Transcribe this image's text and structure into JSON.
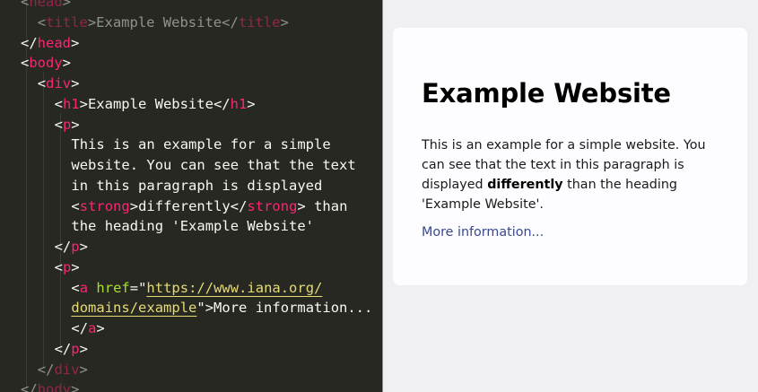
{
  "editor": {
    "lines": [
      {
        "indent": 1,
        "dim": true,
        "tokens": [
          {
            "t": "<",
            "c": "bk"
          },
          {
            "t": "head",
            "c": "tg"
          },
          {
            "t": ">",
            "c": "bk"
          }
        ]
      },
      {
        "indent": 2,
        "dim": true,
        "tokens": [
          {
            "t": "<",
            "c": "bk"
          },
          {
            "t": "title",
            "c": "tg"
          },
          {
            "t": ">",
            "c": "bk"
          },
          {
            "t": "Example Website",
            "c": "bk"
          },
          {
            "t": "</",
            "c": "bk"
          },
          {
            "t": "title",
            "c": "tg"
          },
          {
            "t": ">",
            "c": "bk"
          }
        ]
      },
      {
        "indent": 1,
        "dim": false,
        "tokens": [
          {
            "t": "</",
            "c": "bk"
          },
          {
            "t": "head",
            "c": "tg"
          },
          {
            "t": ">",
            "c": "bk"
          }
        ]
      },
      {
        "indent": 1,
        "dim": false,
        "tokens": [
          {
            "t": "<",
            "c": "bk"
          },
          {
            "t": "body",
            "c": "tg"
          },
          {
            "t": ">",
            "c": "bk"
          }
        ]
      },
      {
        "indent": 2,
        "dim": false,
        "tokens": [
          {
            "t": "<",
            "c": "bk"
          },
          {
            "t": "div",
            "c": "tg"
          },
          {
            "t": ">",
            "c": "bk"
          }
        ]
      },
      {
        "indent": 3,
        "dim": false,
        "tokens": [
          {
            "t": "<",
            "c": "bk"
          },
          {
            "t": "h1",
            "c": "tg"
          },
          {
            "t": ">",
            "c": "bk"
          },
          {
            "t": "Example Website",
            "c": "bk"
          },
          {
            "t": "</",
            "c": "bk"
          },
          {
            "t": "h1",
            "c": "tg"
          },
          {
            "t": ">",
            "c": "bk"
          }
        ]
      },
      {
        "indent": 3,
        "dim": false,
        "tokens": [
          {
            "t": "<",
            "c": "bk"
          },
          {
            "t": "p",
            "c": "tg"
          },
          {
            "t": ">",
            "c": "bk"
          }
        ]
      },
      {
        "indent": 4,
        "dim": false,
        "tokens": [
          {
            "t": "This is an example for a simple",
            "c": "bk"
          }
        ]
      },
      {
        "indent": 4,
        "dim": false,
        "tokens": [
          {
            "t": "website. You can see that the text",
            "c": "bk"
          }
        ]
      },
      {
        "indent": 4,
        "dim": false,
        "tokens": [
          {
            "t": "in this paragraph is displayed",
            "c": "bk"
          }
        ]
      },
      {
        "indent": 4,
        "dim": false,
        "tokens": [
          {
            "t": "<",
            "c": "bk"
          },
          {
            "t": "strong",
            "c": "tg"
          },
          {
            "t": ">",
            "c": "bk"
          },
          {
            "t": "differently",
            "c": "bk"
          },
          {
            "t": "</",
            "c": "bk"
          },
          {
            "t": "strong",
            "c": "tg"
          },
          {
            "t": ">",
            "c": "bk"
          },
          {
            "t": " than",
            "c": "bk"
          }
        ]
      },
      {
        "indent": 4,
        "dim": false,
        "tokens": [
          {
            "t": "the heading 'Example Website'",
            "c": "bk"
          }
        ]
      },
      {
        "indent": 3,
        "dim": false,
        "tokens": [
          {
            "t": "</",
            "c": "bk"
          },
          {
            "t": "p",
            "c": "tg"
          },
          {
            "t": ">",
            "c": "bk"
          }
        ]
      },
      {
        "indent": 3,
        "dim": false,
        "tokens": [
          {
            "t": "<",
            "c": "bk"
          },
          {
            "t": "p",
            "c": "tg"
          },
          {
            "t": ">",
            "c": "bk"
          }
        ]
      },
      {
        "indent": 4,
        "dim": false,
        "tokens": [
          {
            "t": "<",
            "c": "bk"
          },
          {
            "t": "a",
            "c": "tg"
          },
          {
            "t": " ",
            "c": "bk"
          },
          {
            "t": "href",
            "c": "at"
          },
          {
            "t": "=\"",
            "c": "bk"
          },
          {
            "t": "https://www.iana.org/",
            "c": "sv"
          }
        ]
      },
      {
        "indent": 4,
        "dim": false,
        "tokens": [
          {
            "t": "domains/example",
            "c": "sv"
          },
          {
            "t": "\">",
            "c": "bk"
          },
          {
            "t": "More information...",
            "c": "bk"
          }
        ]
      },
      {
        "indent": 4,
        "dim": false,
        "tokens": [
          {
            "t": "</",
            "c": "bk"
          },
          {
            "t": "a",
            "c": "tg"
          },
          {
            "t": ">",
            "c": "bk"
          }
        ]
      },
      {
        "indent": 3,
        "dim": false,
        "tokens": [
          {
            "t": "</",
            "c": "bk"
          },
          {
            "t": "p",
            "c": "tg"
          },
          {
            "t": ">",
            "c": "bk"
          }
        ]
      },
      {
        "indent": 2,
        "dim": true,
        "tokens": [
          {
            "t": "</",
            "c": "bk"
          },
          {
            "t": "div",
            "c": "tg"
          },
          {
            "t": ">",
            "c": "bk"
          }
        ]
      },
      {
        "indent": 1,
        "dim": true,
        "tokens": [
          {
            "t": "</",
            "c": "bk"
          },
          {
            "t": "body",
            "c": "tg"
          },
          {
            "t": ">",
            "c": "bk"
          }
        ]
      }
    ]
  },
  "preview": {
    "heading": "Example Website",
    "paragraph_before": "This is an example for a simple website. You can see that the text in this paragraph is displayed ",
    "paragraph_strong": "differently",
    "paragraph_after": " than the heading 'Example Website'.",
    "link_text": "More information..."
  },
  "colors": {
    "editor_bg": "#272822",
    "tag": "#f92672",
    "attribute": "#a6e22e",
    "string": "#e6db74",
    "text": "#f8f8f2",
    "link": "#38488f",
    "preview_bg": "#f0f0f2",
    "card_bg": "#fdfdff"
  }
}
